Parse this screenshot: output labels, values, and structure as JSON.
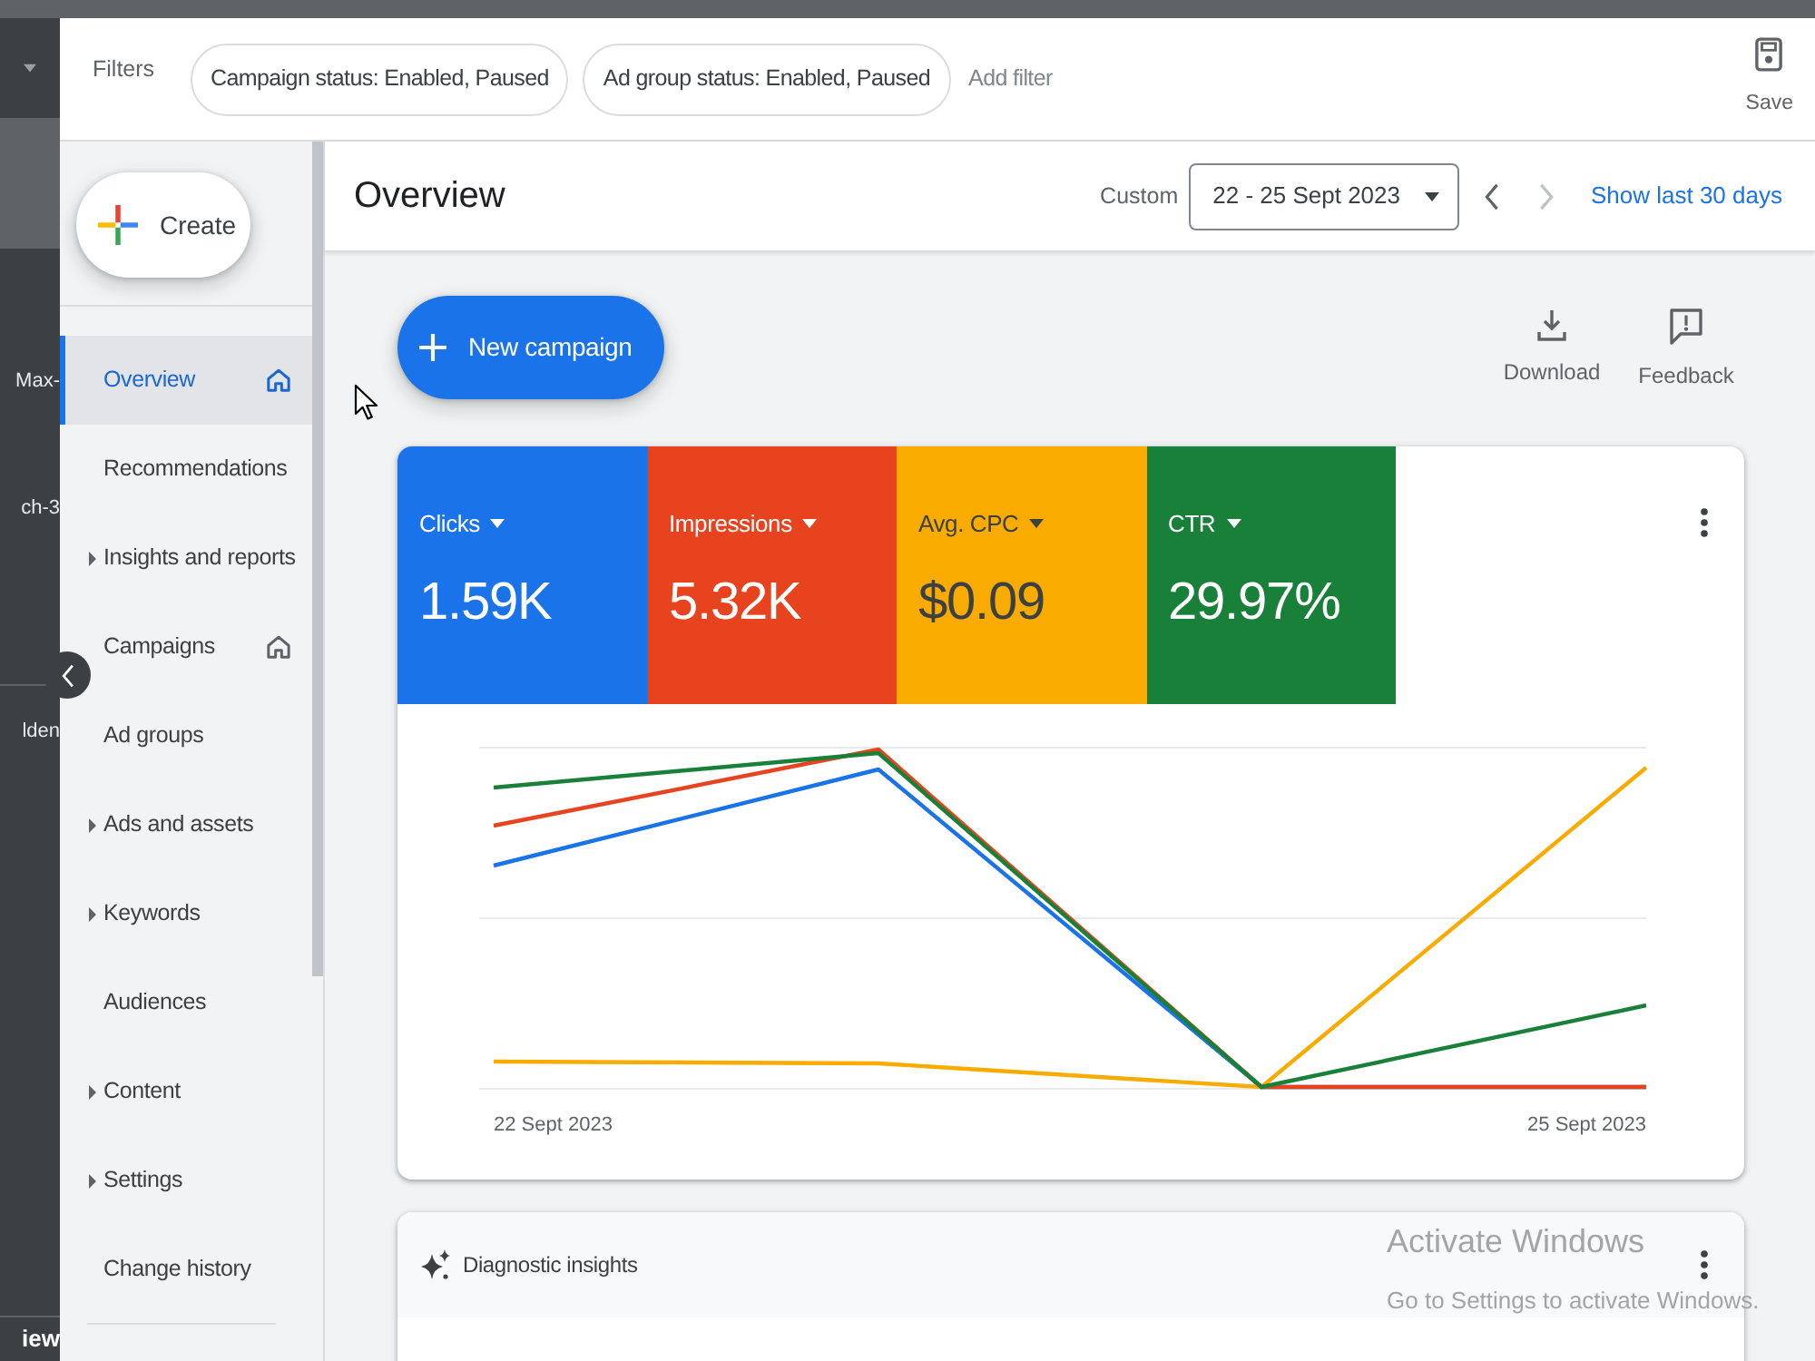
{
  "left_rail": {
    "groups": [
      [
        {
          "selected": true
        },
        {
          "text": "Max-",
          "selected": false
        },
        {
          "text": "ch-3",
          "selected": false
        }
      ],
      [
        {
          "text": "lden",
          "selected": false
        }
      ]
    ],
    "footer": "iew"
  },
  "filter_bar": {
    "label": "Filters",
    "chips": [
      "Campaign status: Enabled, Paused",
      "Ad group status: Enabled, Paused"
    ],
    "add_filter": "Add filter",
    "save": "Save"
  },
  "sidebar": {
    "create": "Create",
    "items": [
      {
        "label": "Overview",
        "selected": true,
        "expandable": false,
        "home_icon": true
      },
      {
        "label": "Recommendations",
        "selected": false,
        "expandable": false,
        "home_icon": false
      },
      {
        "label": "Insights and reports",
        "selected": false,
        "expandable": true,
        "home_icon": false
      },
      {
        "label": "Campaigns",
        "selected": false,
        "expandable": false,
        "home_icon": true
      },
      {
        "label": "Ad groups",
        "selected": false,
        "expandable": false,
        "home_icon": false
      },
      {
        "label": "Ads and assets",
        "selected": false,
        "expandable": true,
        "home_icon": false
      },
      {
        "label": "Keywords",
        "selected": false,
        "expandable": true,
        "home_icon": false
      },
      {
        "label": "Audiences",
        "selected": false,
        "expandable": false,
        "home_icon": false
      },
      {
        "label": "Content",
        "selected": false,
        "expandable": true,
        "home_icon": false
      },
      {
        "label": "Settings",
        "selected": false,
        "expandable": true,
        "home_icon": false
      },
      {
        "label": "Change history",
        "selected": false,
        "expandable": false,
        "home_icon": false
      }
    ]
  },
  "header": {
    "title": "Overview",
    "preset": "Custom",
    "date_range": "22 - 25 Sept 2023",
    "previous": {
      "disabled": false
    },
    "next": {
      "disabled": true
    },
    "link": "Show last 30 days"
  },
  "toolbar": {
    "new_campaign": "New campaign",
    "actions": [
      {
        "kind": "download",
        "label": "Download"
      },
      {
        "kind": "feedback",
        "label": "Feedback"
      }
    ]
  },
  "metrics": [
    {
      "name": "Clicks",
      "value": "1.59K",
      "color": "#1a73e8"
    },
    {
      "name": "Impressions",
      "value": "5.32K",
      "color": "#e8431f"
    },
    {
      "name": "Avg. CPC",
      "value": "$0.09",
      "color": "#f9ab00"
    },
    {
      "name": "CTR",
      "value": "29.97%",
      "color": "#188038"
    }
  ],
  "chart": {
    "x_labels": [
      "22 Sept 2023",
      "25 Sept 2023"
    ]
  },
  "insights": {
    "title": "Diagnostic insights"
  },
  "os_notice": {
    "title": "Activate Windows",
    "text": "Go to Settings to activate Windows."
  }
}
